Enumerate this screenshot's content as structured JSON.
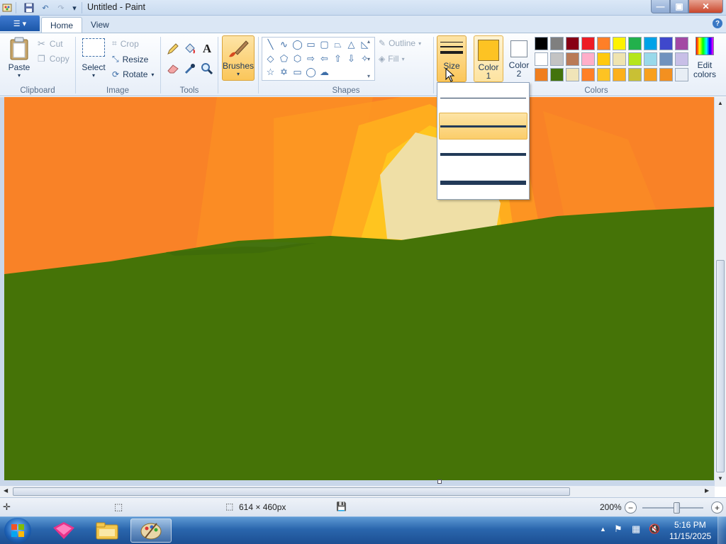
{
  "window": {
    "title": "Untitled - Paint",
    "minimize_glyph": "—",
    "maximize_glyph": "▣",
    "close_glyph": "✕"
  },
  "tabs": {
    "file_glyph": "☰ ▾",
    "home": "Home",
    "view": "View",
    "help_glyph": "?"
  },
  "clipboard": {
    "paste": "Paste",
    "cut": "Cut",
    "copy": "Copy",
    "group": "Clipboard"
  },
  "image": {
    "select": "Select",
    "crop": "Crop",
    "resize": "Resize",
    "rotate": "Rotate",
    "group": "Image"
  },
  "tools": {
    "group": "Tools"
  },
  "brushes": {
    "label": "Brushes"
  },
  "shapes": {
    "outline": "Outline",
    "fill": "Fill",
    "group": "Shapes"
  },
  "size": {
    "label": "Size",
    "selected_option": 2,
    "options": [
      "size-1px",
      "size-3px",
      "size-5px",
      "size-8px"
    ]
  },
  "colors": {
    "color1_label_a": "Color",
    "color1_label_b": "1",
    "color2_label_a": "Color",
    "color2_label_b": "2",
    "edit_label_a": "Edit",
    "edit_label_b": "colors",
    "group": "Colors",
    "color1_value": "#fdc323",
    "color2_value": "#ffffff",
    "palette_row1": [
      "#000000",
      "#7f7f7f",
      "#880015",
      "#ed1c24",
      "#ff7f27",
      "#fff200",
      "#22b14c",
      "#00a2e8",
      "#3f48cc",
      "#a349a4"
    ],
    "palette_row2": [
      "#ffffff",
      "#c3c3c3",
      "#b97a57",
      "#ffaec9",
      "#ffc90e",
      "#efe4b0",
      "#b5e61d",
      "#99d9ea",
      "#7092be",
      "#c8bfe7"
    ],
    "palette_row3": [
      "#f07e1e",
      "#43730c",
      "#f0e4b8",
      "#ff7f27",
      "#fdc323",
      "#fdb01c",
      "#c9c034",
      "#f8a01d",
      "#f39020",
      "#e8eef5"
    ]
  },
  "status": {
    "canvas_size": "614 × 460px",
    "zoom": "200%"
  },
  "taskbar": {
    "time": "5:16 PM",
    "date": "11/15/2025"
  }
}
